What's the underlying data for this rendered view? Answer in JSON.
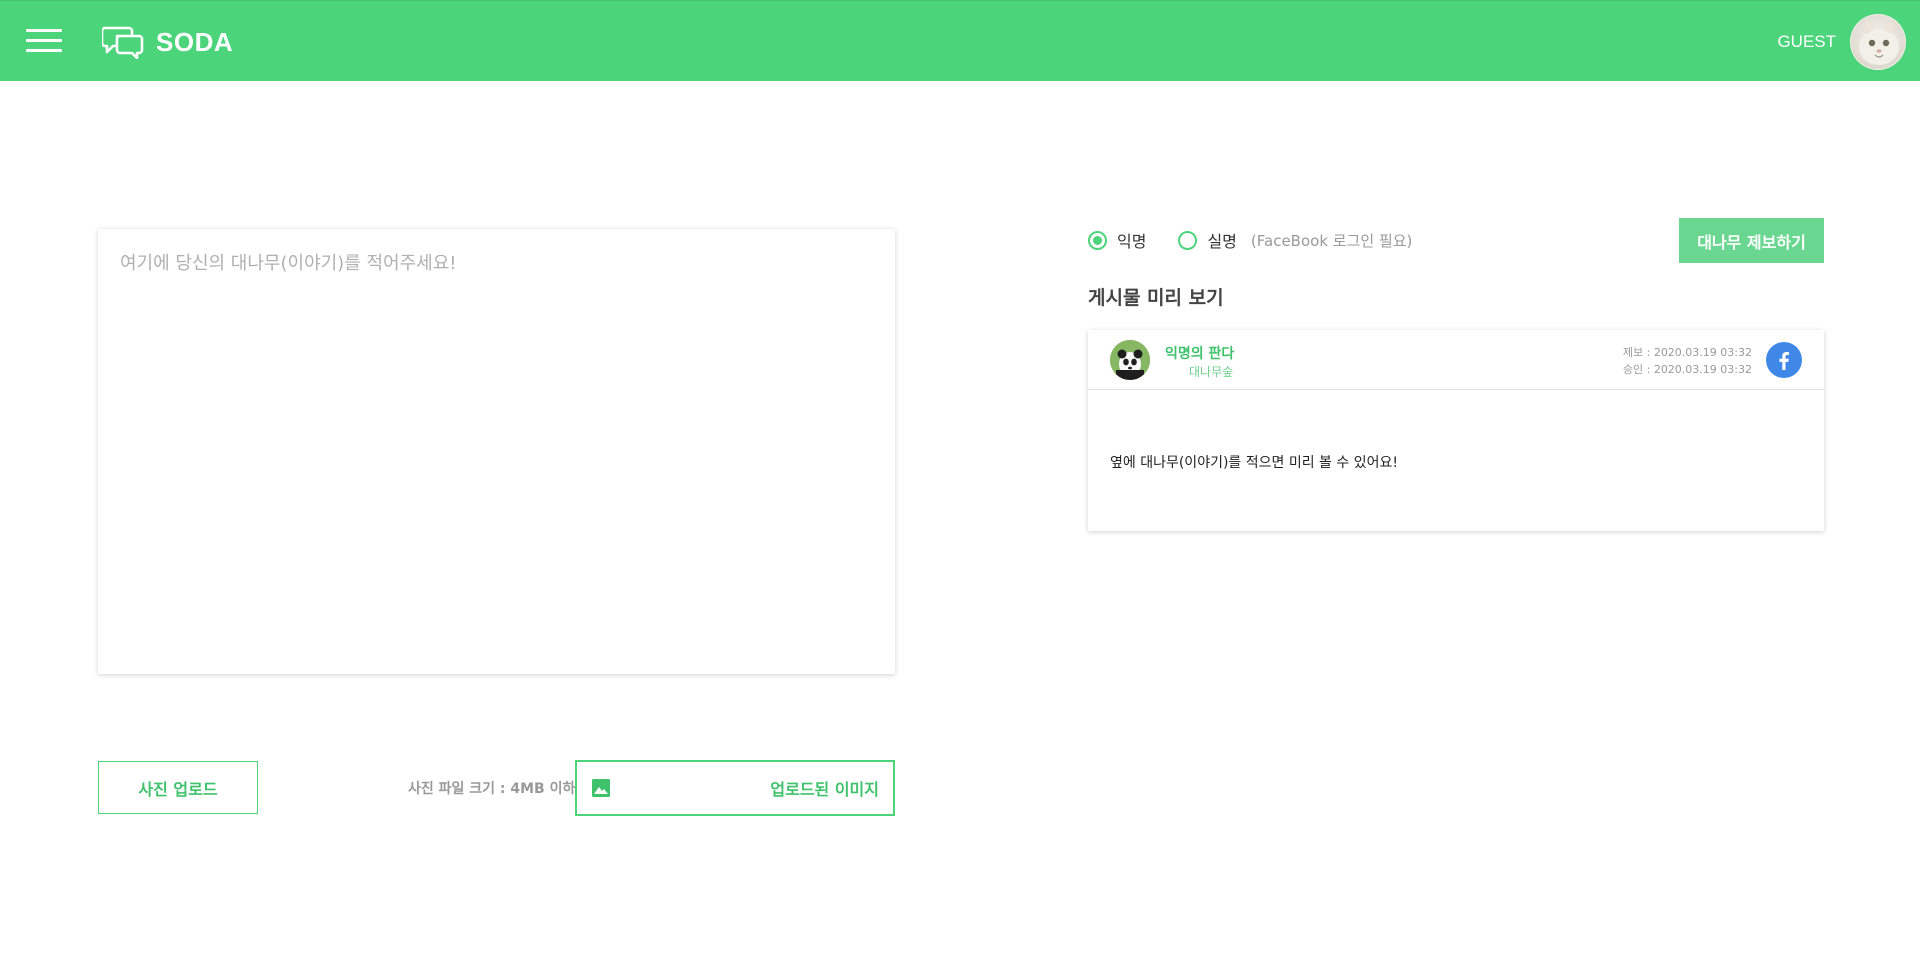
{
  "header": {
    "app_name": "SODA",
    "user_label": "GUEST",
    "menu_icon": "menu-icon",
    "logo_icon": "chat-bubbles-icon"
  },
  "editor": {
    "placeholder": "여기에 당신의 대나무(이야기)를 적어주세요!"
  },
  "upload": {
    "button_label": "사진 업로드",
    "file_limit": "사진 파일 크기 : 4MB 이하",
    "uploaded_label": "업로드된 이미지",
    "image_icon": "image-icon"
  },
  "options": {
    "anonymous_label": "익명",
    "realname_label": "실명",
    "realname_note": "(FaceBook 로그인 필요)",
    "selected": "익명"
  },
  "submit_label": "대나무 제보하기",
  "preview": {
    "title": "게시물 미리 보기",
    "author": "익명의 판다",
    "subtitle": "대나무숲",
    "reported": "제보 : 2020.03.19 03:32",
    "approved": "승인 : 2020.03.19 03:32",
    "body": "옆에 대나무(이야기)를 적으면 미리 볼 수 있어요!"
  },
  "colors": {
    "brand_green": "#4cd47a",
    "facebook_blue": "#3f88e8"
  }
}
